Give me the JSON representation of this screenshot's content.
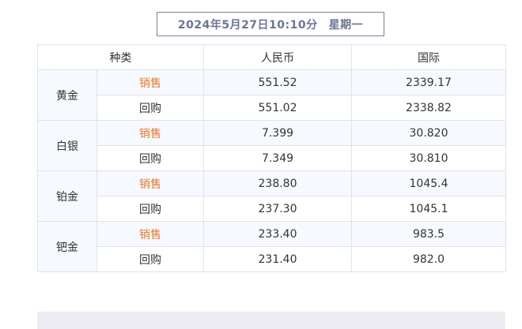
{
  "header": {
    "datetime": "2024年5月27日10:10分",
    "weekday": "星期一"
  },
  "table": {
    "columns": [
      "种类",
      "人民币",
      "国际"
    ],
    "groups": [
      {
        "metal": "黄金",
        "rows": [
          {
            "type": "销售",
            "cny": "551.52",
            "intl": "2339.17"
          },
          {
            "type": "回购",
            "cny": "551.02",
            "intl": "2338.82"
          }
        ]
      },
      {
        "metal": "白银",
        "rows": [
          {
            "type": "销售",
            "cny": "7.399",
            "intl": "30.820"
          },
          {
            "type": "回购",
            "cny": "7.349",
            "intl": "30.810"
          }
        ]
      },
      {
        "metal": "铂金",
        "rows": [
          {
            "type": "销售",
            "cny": "238.80",
            "intl": "1045.4"
          },
          {
            "type": "回购",
            "cny": "237.30",
            "intl": "1045.1"
          }
        ]
      },
      {
        "metal": "钯金",
        "rows": [
          {
            "type": "销售",
            "cny": "233.40",
            "intl": "983.5"
          },
          {
            "type": "回购",
            "cny": "231.40",
            "intl": "982.0"
          }
        ]
      }
    ]
  },
  "colors": {
    "sell_accent": "#e6782e",
    "header_text": "#6c7595",
    "border": "#dfe3ea"
  }
}
